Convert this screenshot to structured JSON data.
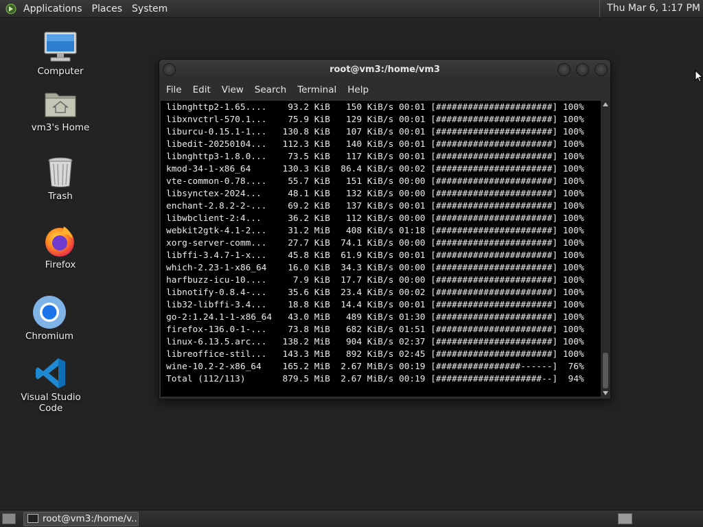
{
  "top_panel": {
    "menus": [
      "Applications",
      "Places",
      "System"
    ],
    "clock": "Thu Mar  6,  1:17 PM"
  },
  "desktop": {
    "icons": [
      {
        "label": "Computer",
        "icon": "computer-icon"
      },
      {
        "label": "vm3's Home",
        "icon": "home-folder-icon"
      },
      {
        "label": "Trash",
        "icon": "trash-icon"
      },
      {
        "label": "Firefox",
        "icon": "firefox-icon"
      },
      {
        "label": "Chromium",
        "icon": "chromium-icon"
      },
      {
        "label": "Visual Studio Code",
        "icon": "vscode-icon"
      }
    ]
  },
  "terminal": {
    "title": "root@vm3:/home/vm3",
    "menu": [
      "File",
      "Edit",
      "View",
      "Search",
      "Terminal",
      "Help"
    ],
    "lines": [
      "libnghttp2-1.65....    93.2 KiB   150 KiB/s 00:01 [######################] 100%",
      "libxnvctrl-570.1...    75.9 KiB   129 KiB/s 00:01 [######################] 100%",
      "liburcu-0.15.1-1...   130.8 KiB   107 KiB/s 00:01 [######################] 100%",
      "libedit-20250104...   112.3 KiB   140 KiB/s 00:01 [######################] 100%",
      "libnghttp3-1.8.0...    73.5 KiB   117 KiB/s 00:01 [######################] 100%",
      "kmod-34-1-x86_64      130.3 KiB  86.4 KiB/s 00:02 [######################] 100%",
      "vte-common-0.78....    55.7 KiB   151 KiB/s 00:00 [######################] 100%",
      "libsynctex-2024...     48.1 KiB   132 KiB/s 00:00 [######################] 100%",
      "enchant-2.8.2-2-...    69.2 KiB   137 KiB/s 00:01 [######################] 100%",
      "libwbclient-2:4...     36.2 KiB   112 KiB/s 00:00 [######################] 100%",
      "webkit2gtk-4.1-2...    31.2 MiB   408 KiB/s 01:18 [######################] 100%",
      "xorg-server-comm...    27.7 KiB  74.1 KiB/s 00:00 [######################] 100%",
      "libffi-3.4.7-1-x...    45.8 KiB  61.9 KiB/s 00:01 [######################] 100%",
      "which-2.23-1-x86_64    16.0 KiB  34.3 KiB/s 00:00 [######################] 100%",
      "harfbuzz-icu-10....     7.9 KiB  17.7 KiB/s 00:00 [######################] 100%",
      "libnotify-0.8.4-...    35.6 KiB  23.4 KiB/s 00:02 [######################] 100%",
      "lib32-libffi-3.4...    18.8 KiB  14.4 KiB/s 00:01 [######################] 100%",
      "go-2:1.24.1-1-x86_64   43.0 MiB   489 KiB/s 01:30 [######################] 100%",
      "firefox-136.0-1-...    73.8 MiB   682 KiB/s 01:51 [######################] 100%",
      "linux-6.13.5.arc...   138.2 MiB   904 KiB/s 02:37 [######################] 100%",
      "libreoffice-stil...   143.3 MiB   892 KiB/s 02:45 [######################] 100%",
      "wine-10.2-2-x86_64    165.2 MiB  2.67 MiB/s 00:19 [################------]  76%",
      "Total (112/113)       879.5 MiB  2.67 MiB/s 00:19 [####################--]  94%"
    ]
  },
  "taskbar": {
    "window_button": "root@vm3:/home/v..."
  }
}
